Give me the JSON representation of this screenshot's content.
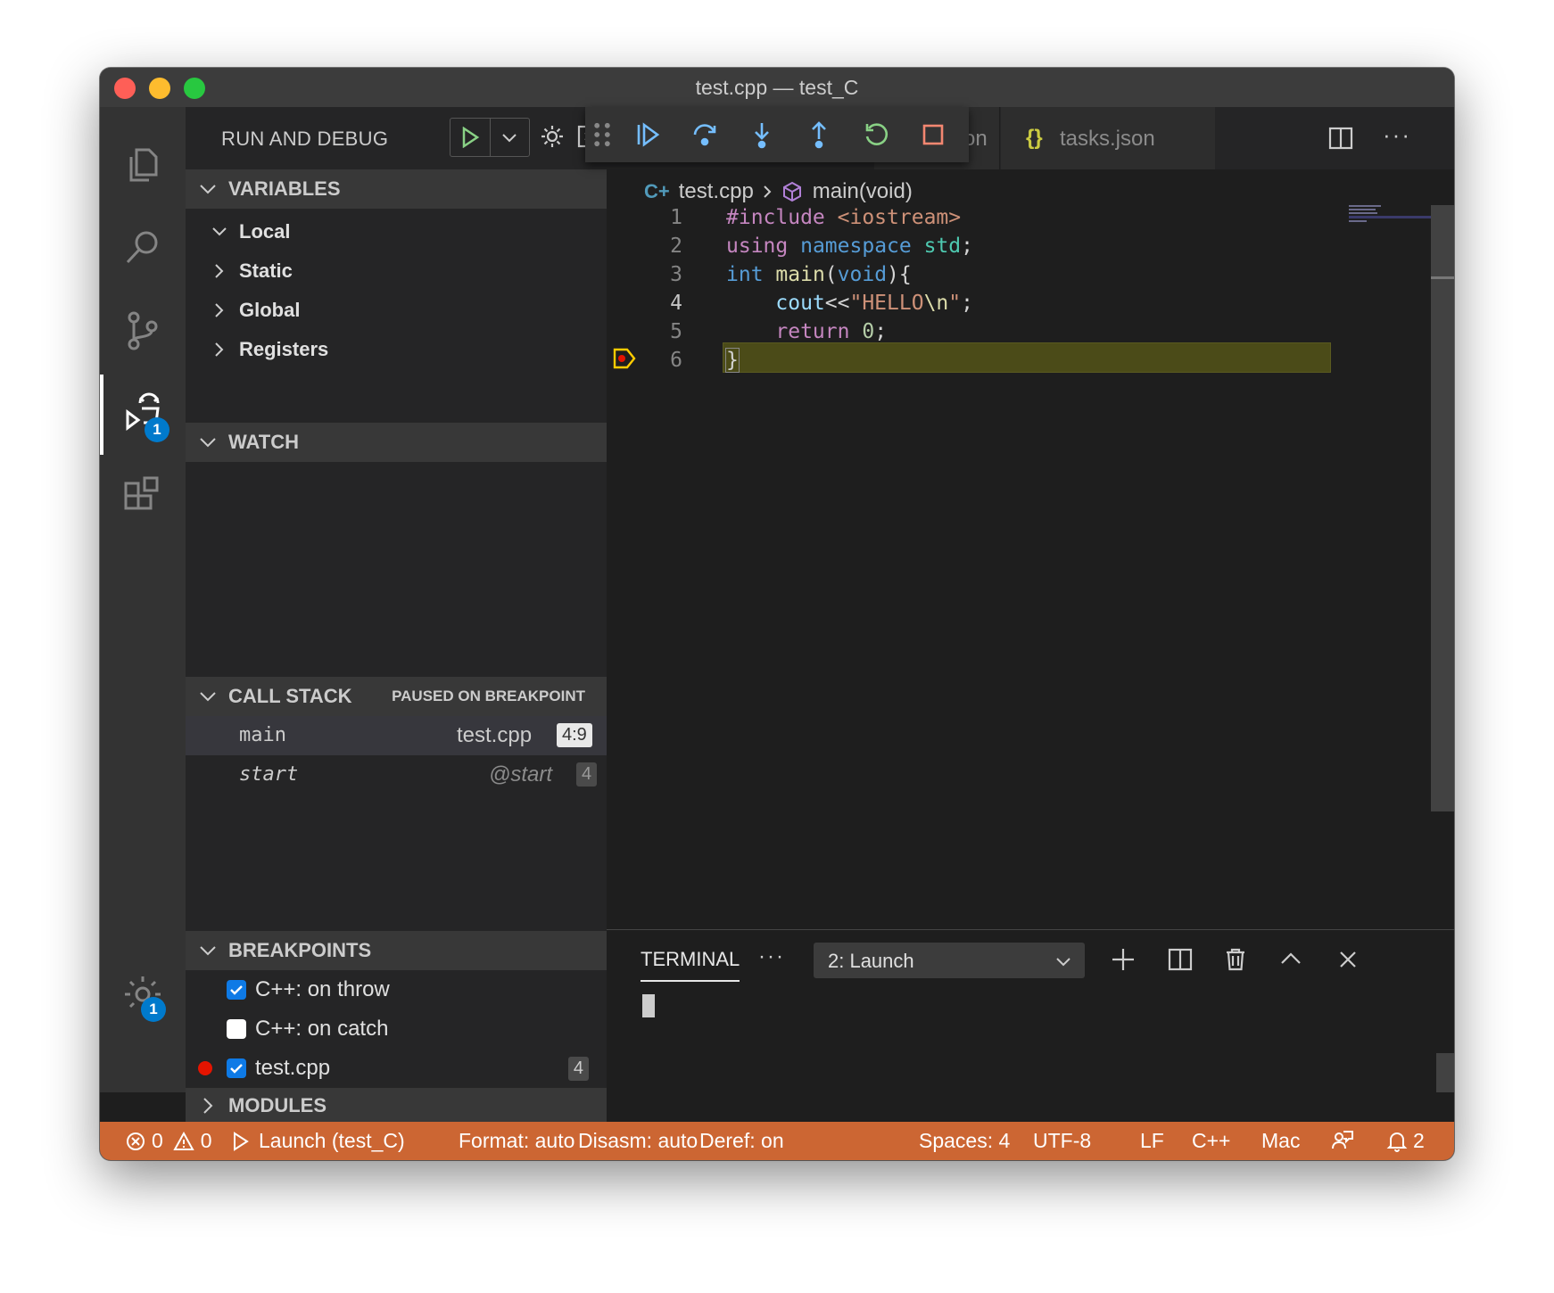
{
  "window": {
    "title": "test.cpp — test_C"
  },
  "activity_bar": {
    "debug_badge": "1",
    "settings_badge": "1"
  },
  "sidebar": {
    "header_label": "RUN AND DEBUG",
    "variables": {
      "title": "VARIABLES",
      "scopes": [
        "Local",
        "Static",
        "Global",
        "Registers"
      ]
    },
    "watch": {
      "title": "WATCH"
    },
    "call_stack": {
      "title": "CALL STACK",
      "state": "PAUSED ON BREAKPOINT",
      "frames": [
        {
          "name": "main",
          "file": "test.cpp",
          "position": "4:9"
        },
        {
          "name": "start",
          "file": "@start",
          "position": "4"
        }
      ]
    },
    "breakpoints": {
      "title": "BREAKPOINTS",
      "items": [
        {
          "label": "C++: on throw",
          "checked": true
        },
        {
          "label": "C++: on catch",
          "checked": false
        },
        {
          "label": "test.cpp",
          "checked": true,
          "count": "4"
        }
      ]
    },
    "modules": {
      "title": "MODULES"
    }
  },
  "tabs": {
    "partial_tab": "on",
    "tasks_tab": "tasks.json",
    "tasks_icon": "{}"
  },
  "breadcrumb": {
    "file": "test.cpp",
    "symbol": "main(void)"
  },
  "code": {
    "current_line": 4,
    "line_numbers": [
      "1",
      "2",
      "3",
      "4",
      "5",
      "6"
    ]
  },
  "panel": {
    "tab": "TERMINAL",
    "more": "···",
    "terminal_select": "2: Launch"
  },
  "status_bar": {
    "errors": "0",
    "warnings": "0",
    "launch": "Launch (test_C)",
    "format": "Format: auto",
    "disasm": "Disasm: auto",
    "deref": "Deref: on",
    "spaces": "Spaces: 4",
    "encoding": "UTF-8",
    "eol": "LF",
    "language": "C++",
    "platform": "Mac",
    "notifications": "2"
  }
}
